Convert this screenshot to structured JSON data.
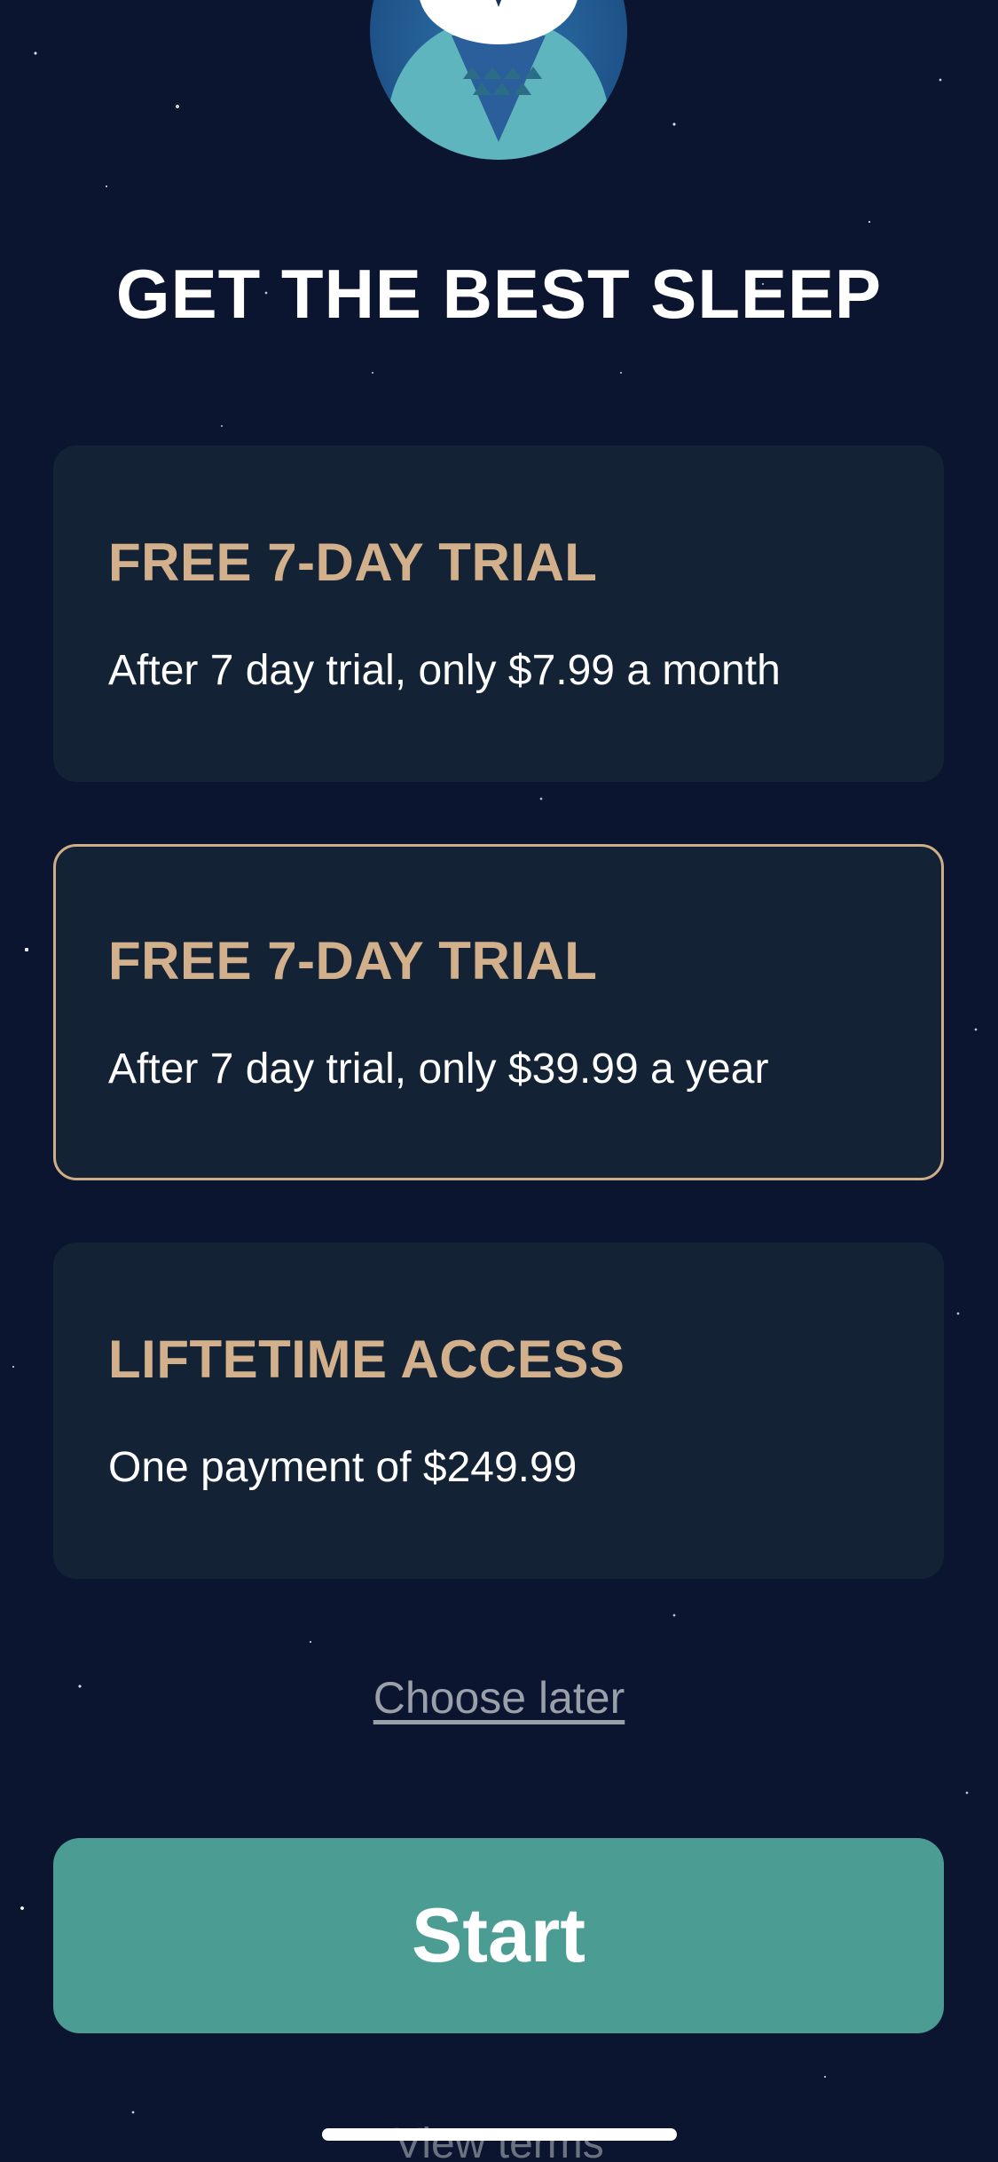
{
  "headline": "GET THE BEST SLEEP",
  "plans": [
    {
      "title": "FREE 7-DAY TRIAL",
      "description": "After 7 day trial, only $7.99 a month",
      "selected": false
    },
    {
      "title": "FREE 7-DAY TRIAL",
      "description": "After 7 day trial, only $39.99 a year",
      "selected": true
    },
    {
      "title": "LIFTETIME ACCESS",
      "description": "One payment of $249.99",
      "selected": false
    }
  ],
  "choose_later_label": "Choose later",
  "start_label": "Start",
  "view_terms_label": "View terms",
  "icons": {
    "logo": "owl-logo-icon"
  },
  "colors": {
    "background": "#0b1530",
    "card": "#132335",
    "accent_gold": "#d2b08c",
    "start_button": "#4b9d94",
    "link_gray": "#9aa0a9"
  }
}
